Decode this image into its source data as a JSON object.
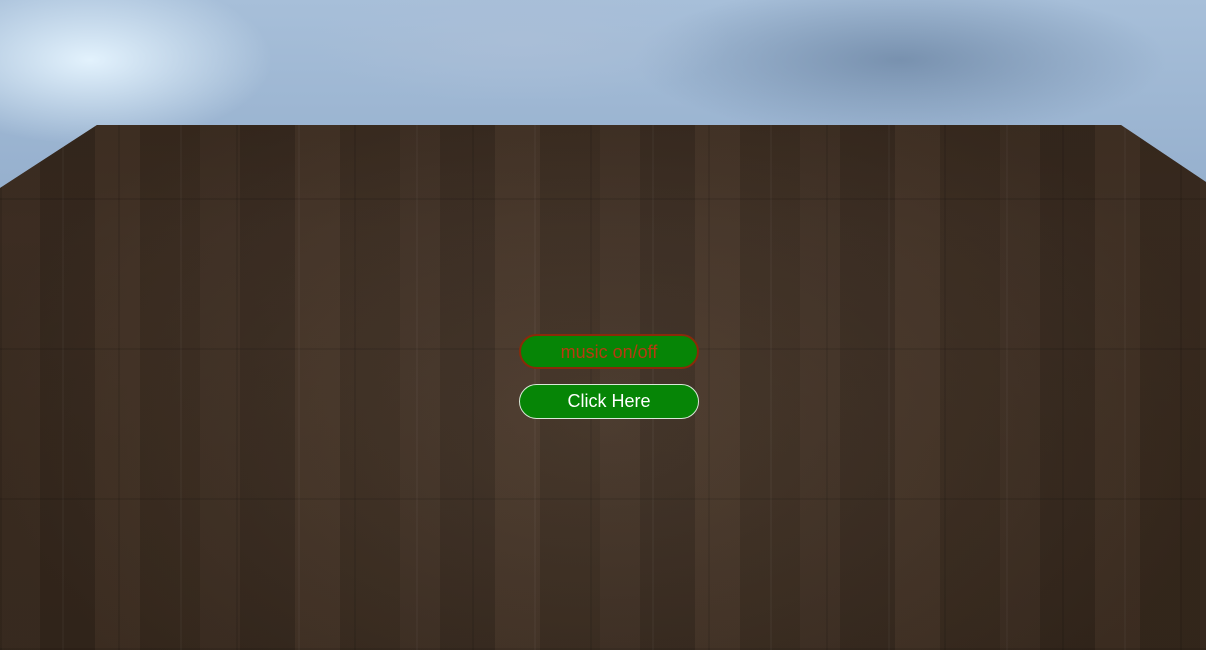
{
  "buttons": {
    "music_label": "music on/off",
    "click_label": "Click Here"
  },
  "colors": {
    "button_fill": "#068506",
    "music_text": "#b83a10",
    "music_border": "#8a2a0a",
    "click_text": "#ffffff",
    "click_border": "#d8e8d8"
  }
}
